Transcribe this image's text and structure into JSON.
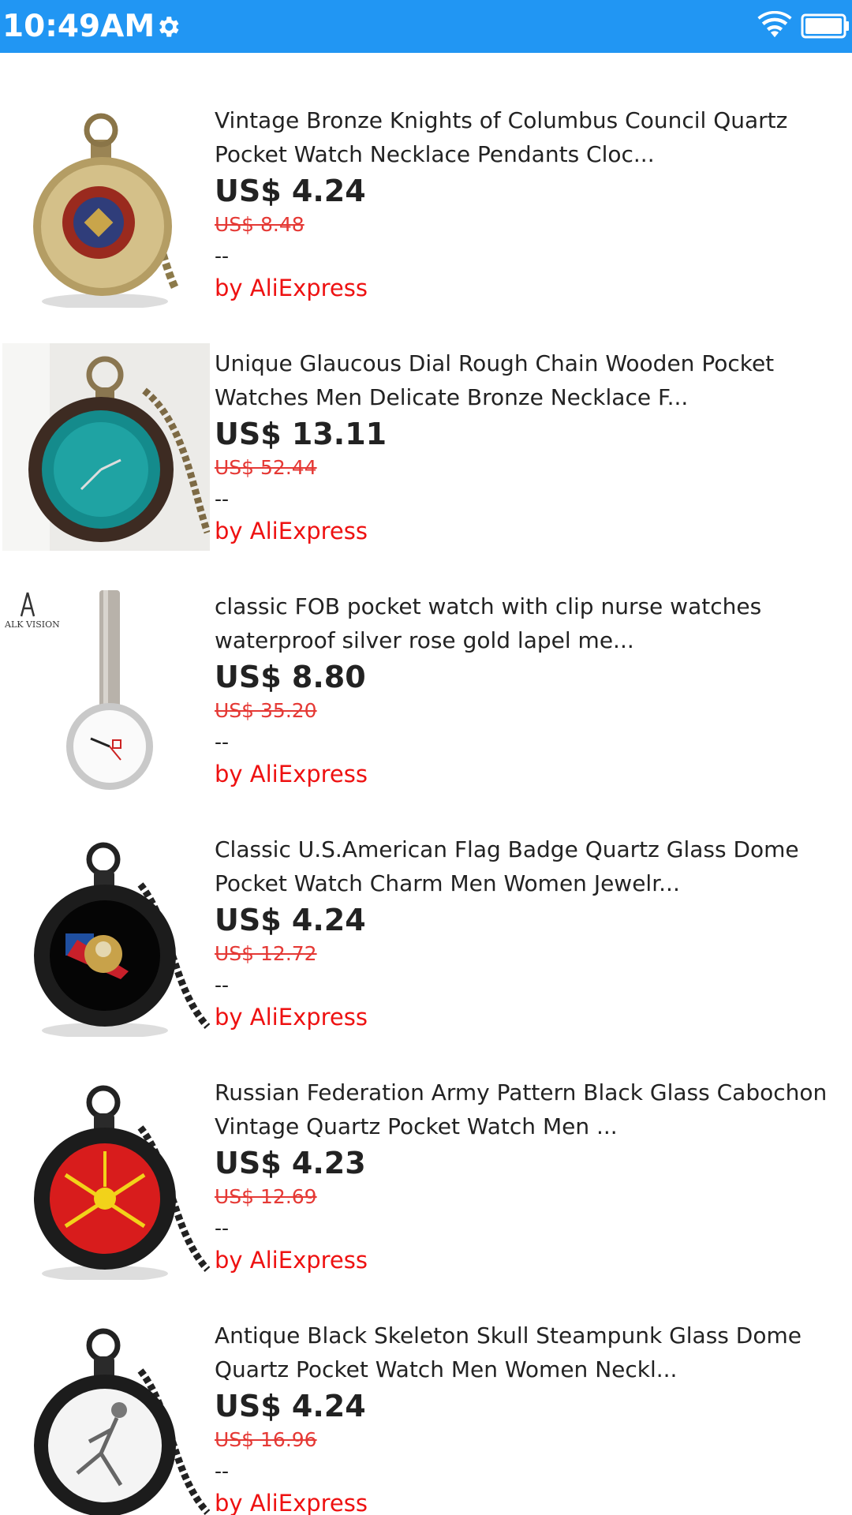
{
  "status_bar": {
    "time": "10:49AM",
    "icons": [
      "gear-icon",
      "wifi-icon",
      "battery-icon"
    ],
    "color": "#2196f3"
  },
  "products": [
    {
      "title": "Vintage Bronze Knights of Columbus Council Quartz Pocket Watch Necklace Pendants Cloc...",
      "price": "US$ 4.24",
      "original_price": "US$ 8.48",
      "rating": "--",
      "seller": "by AliExpress",
      "image": "bronze-pocket-watch-knights-of-columbus"
    },
    {
      "title": "Unique Glaucous Dial Rough Chain Wooden Pocket Watches Men Delicate Bronze Necklace F...",
      "price": "US$ 13.11",
      "original_price": "US$ 52.44",
      "rating": "--",
      "seller": "by AliExpress",
      "image": "wooden-pocket-watch-teal-dial"
    },
    {
      "title": "classic FOB pocket watch with clip nurse watches waterproof silver rose gold lapel me...",
      "price": "US$ 8.80",
      "original_price": "US$ 35.20",
      "rating": "--",
      "seller": "by AliExpress",
      "image": "nurse-fob-watch-clip",
      "image_logo": "ALK VISION"
    },
    {
      "title": "Classic U.S.American Flag Badge Quartz Glass Dome Pocket Watch Charm Men Women Jewelr...",
      "price": "US$ 4.24",
      "original_price": "US$ 12.72",
      "rating": "--",
      "seller": "by AliExpress",
      "image": "black-pocket-watch-eagle-flag"
    },
    {
      "title": "Russian Federation Army Pattern Black Glass Cabochon Vintage Quartz Pocket Watch Men ...",
      "price": "US$ 4.23",
      "original_price": "US$ 12.69",
      "rating": "--",
      "seller": "by AliExpress",
      "image": "black-pocket-watch-red-army-emblem"
    },
    {
      "title": "Antique Black Skeleton Skull Steampunk Glass Dome Quartz Pocket Watch Men Women Neckl...",
      "price": "US$ 4.24",
      "original_price": "US$ 16.96",
      "rating": "--",
      "seller": "by AliExpress",
      "image": "black-pocket-watch-skeleton"
    }
  ]
}
